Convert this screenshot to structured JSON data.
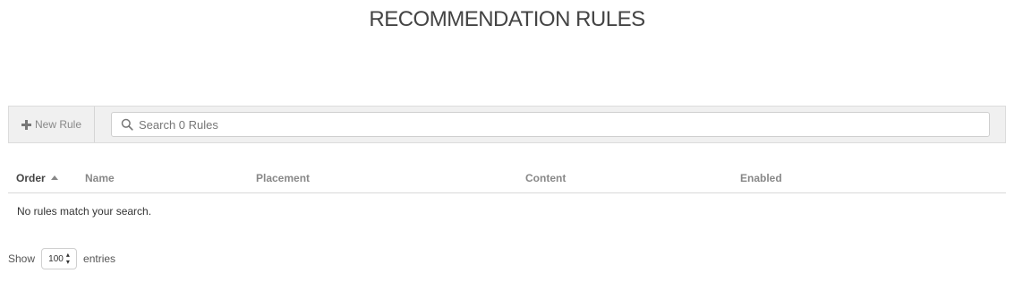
{
  "page": {
    "title": "RECOMMENDATION RULES"
  },
  "toolbar": {
    "new_rule_label": "New Rule",
    "search_placeholder": "Search 0 Rules",
    "search_value": ""
  },
  "table": {
    "columns": [
      "Order",
      "Name",
      "Placement",
      "Content",
      "Enabled"
    ],
    "sort_column": "Order",
    "sort_direction": "ascending",
    "empty_message": "No rules match your search."
  },
  "length": {
    "show_label": "Show",
    "selected": "100",
    "entries_label": "entries"
  },
  "icons": {
    "new_rule": "plus-icon",
    "search": "search-icon",
    "sort": "sort-up-icon",
    "select": "updown-icon"
  }
}
